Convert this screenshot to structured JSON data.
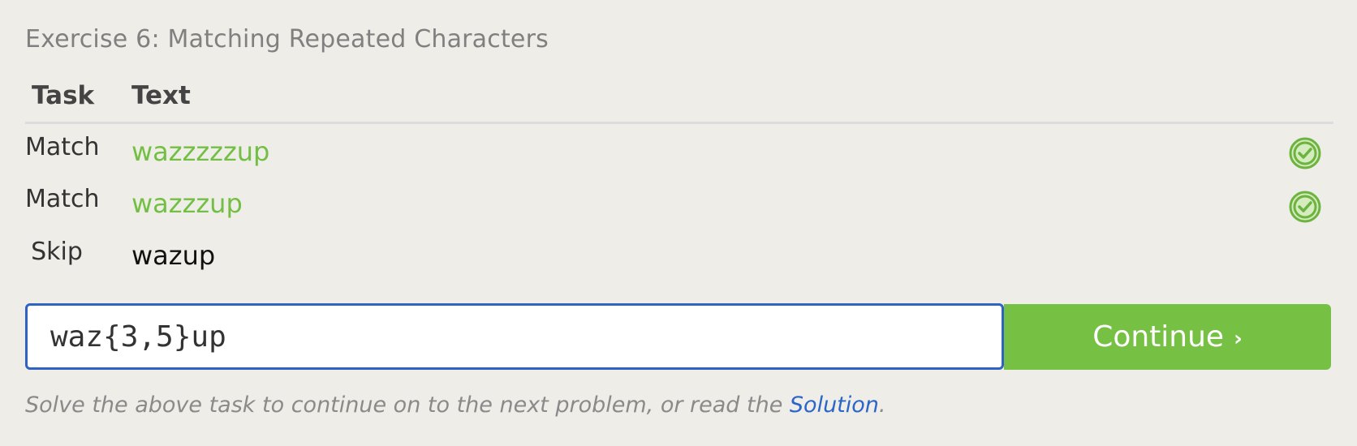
{
  "exercise": {
    "title": "Exercise 6: Matching Repeated Characters"
  },
  "table": {
    "headers": {
      "task": "Task",
      "text": "Text"
    },
    "rows": [
      {
        "task": "Match",
        "text": "wazzzzzup",
        "status": "success"
      },
      {
        "task": "Match",
        "text": "wazzzup",
        "status": "success"
      },
      {
        "task": "Skip",
        "text": "wazup",
        "status": "none"
      }
    ]
  },
  "answer": {
    "value": "waz{3,5}up"
  },
  "continue_button": {
    "label": "Continue",
    "chevron": "›"
  },
  "hint": {
    "before": "Solve the above task to continue on to the next problem, or read the ",
    "link": "Solution",
    "after": "."
  },
  "icons": {
    "status_success": "check-circle-icon"
  },
  "colors": {
    "background": "#efede8",
    "success": "#72bf44",
    "accent_button": "#76c043",
    "input_border": "#2e63c2",
    "link": "#2b65c8"
  }
}
